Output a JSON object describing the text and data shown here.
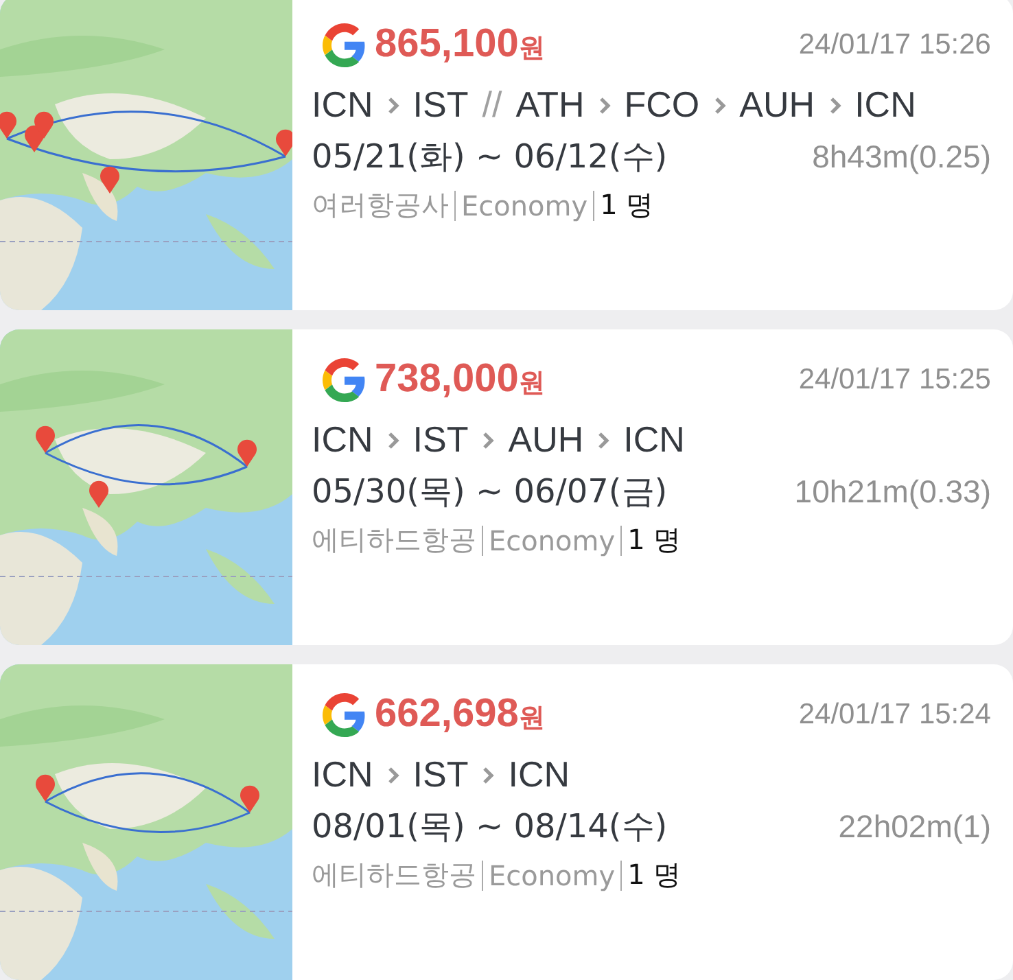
{
  "results": [
    {
      "price": "865,100",
      "currency": "원",
      "timestamp": "24/01/17 15:26",
      "route": [
        {
          "kind": "airport",
          "text": "ICN"
        },
        {
          "kind": "arrow"
        },
        {
          "kind": "airport",
          "text": "IST"
        },
        {
          "kind": "break",
          "text": "//"
        },
        {
          "kind": "airport",
          "text": "ATH"
        },
        {
          "kind": "arrow"
        },
        {
          "kind": "airport",
          "text": "FCO"
        },
        {
          "kind": "arrow"
        },
        {
          "kind": "airport",
          "text": "AUH"
        },
        {
          "kind": "arrow"
        },
        {
          "kind": "airport",
          "text": "ICN"
        }
      ],
      "dates": "05/21(화) ~ 06/12(수)",
      "duration": "8h43m(0.25)",
      "airline": "여러항공사",
      "cabin": "Economy",
      "passengers": "1 명"
    },
    {
      "price": "738,000",
      "currency": "원",
      "timestamp": "24/01/17 15:25",
      "route": [
        {
          "kind": "airport",
          "text": "ICN"
        },
        {
          "kind": "arrow"
        },
        {
          "kind": "airport",
          "text": "IST"
        },
        {
          "kind": "arrow"
        },
        {
          "kind": "airport",
          "text": "AUH"
        },
        {
          "kind": "arrow"
        },
        {
          "kind": "airport",
          "text": "ICN"
        }
      ],
      "dates": "05/30(목) ~ 06/07(금)",
      "duration": "10h21m(0.33)",
      "airline": "에티하드항공",
      "cabin": "Economy",
      "passengers": "1 명"
    },
    {
      "price": "662,698",
      "currency": "원",
      "timestamp": "24/01/17 15:24",
      "route": [
        {
          "kind": "airport",
          "text": "ICN"
        },
        {
          "kind": "arrow"
        },
        {
          "kind": "airport",
          "text": "IST"
        },
        {
          "kind": "arrow"
        },
        {
          "kind": "airport",
          "text": "ICN"
        }
      ],
      "dates": "08/01(목) ~ 08/14(수)",
      "duration": "22h02m(1)",
      "airline": "에티하드항공",
      "cabin": "Economy",
      "passengers": "1 명"
    }
  ]
}
